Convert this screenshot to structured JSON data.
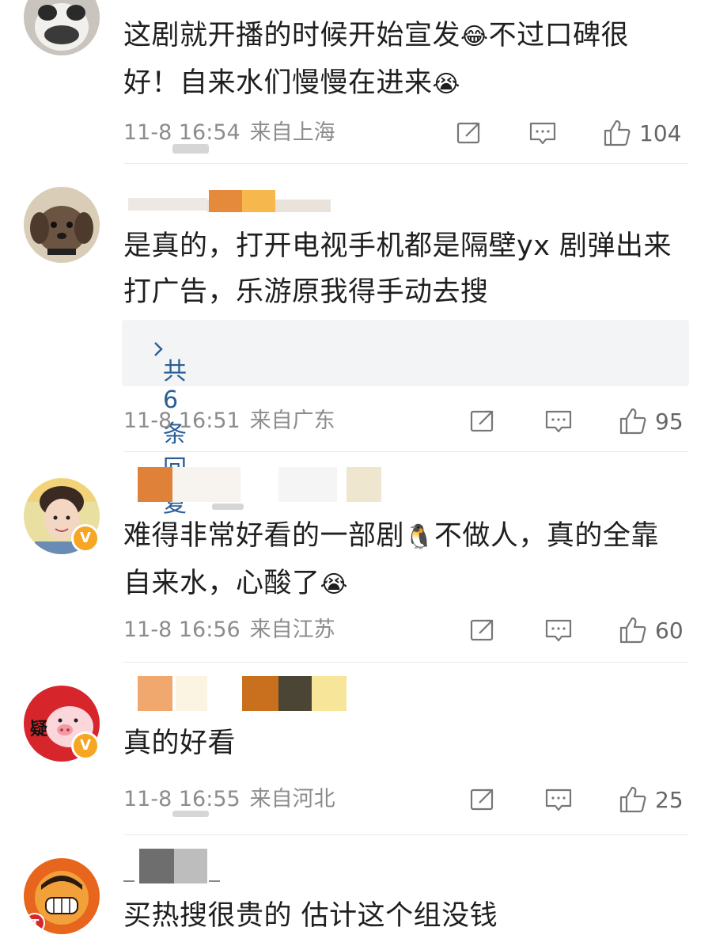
{
  "comments": [
    {
      "text_parts": [
        "这剧就开播的时候开始宣发",
        "😂",
        "不过口碑很好！自来水们慢慢在进来",
        "😭"
      ],
      "time": "11-8 16:54",
      "location": "来自上海",
      "likes": "104"
    },
    {
      "text": "是真的，打开电视手机都是隔壁yx 剧弹出来打广告，乐游原我得手动去搜",
      "replies_label": "共6条回复",
      "time": "11-8 16:51",
      "location": "来自广东",
      "likes": "95"
    },
    {
      "text_parts": [
        "难得非常好看的一部剧",
        "🐧",
        "不做人，真的全靠自来水，心酸了",
        "😭"
      ],
      "time": "11-8 16:56",
      "location": "来自江苏",
      "likes": "60"
    },
    {
      "text": "真的好看",
      "time": "11-8 16:55",
      "location": "来自河北",
      "likes": "25"
    },
    {
      "text": "买热搜很贵的 估计这个组没钱"
    }
  ],
  "badge_label": "V",
  "avatar_text": {
    "c4": "疑",
    "c5": "T"
  },
  "icons": [
    "repost-icon",
    "comment-icon",
    "like-icon",
    "chevron-right-icon",
    "verified-badge-icon"
  ],
  "colors": {
    "link": "#2b5e94",
    "meta": "#8c8c8c",
    "badge": "#f5a623"
  }
}
